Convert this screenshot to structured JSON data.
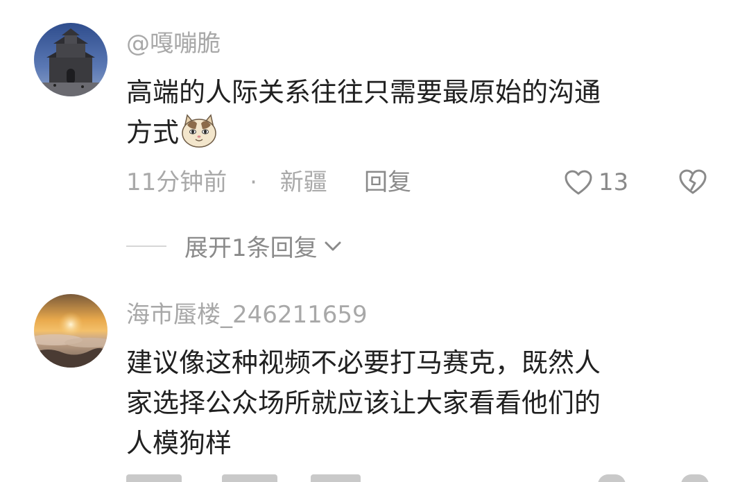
{
  "comments": [
    {
      "username": "@嘎嘣脆",
      "text_line1": "高端的人际关系往往只需要最原始的沟通",
      "text_line2": "方式",
      "emoji": "cat-face-emoji",
      "time": "11分钟前",
      "separator": "·",
      "location": "新疆",
      "reply_label": "回复",
      "likes": "13",
      "expand_label": "展开1条回复"
    },
    {
      "username": "海市蜃楼_246211659",
      "text_line1": "建议像这种视频不必要打马赛克，既然人",
      "text_line2": "家选择公众场所就应该让大家看看他们的",
      "text_line3": "人模狗样"
    }
  ],
  "icons": {
    "like": "heart-outline-icon",
    "dislike": "broken-heart-outline-icon",
    "expand": "chevron-down-icon"
  },
  "colors": {
    "text": "#202020",
    "muted": "#a8a8a8",
    "action": "#8a8a8a",
    "background": "#ffffff"
  }
}
